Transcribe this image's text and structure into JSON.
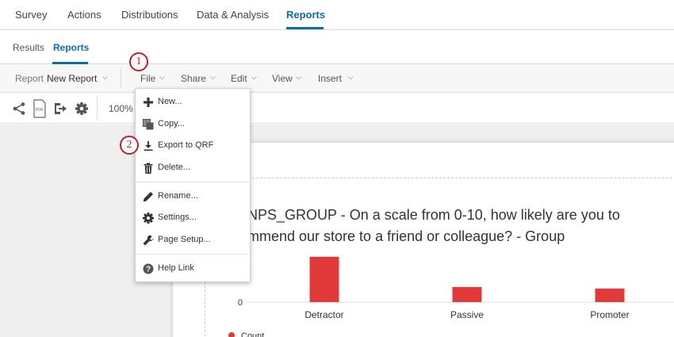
{
  "top_nav": {
    "tabs": [
      "Survey",
      "Actions",
      "Distributions",
      "Data & Analysis",
      "Reports"
    ],
    "active": "Reports"
  },
  "sub_nav": {
    "tabs": [
      "Results",
      "Reports"
    ],
    "active": "Reports"
  },
  "toolbar": {
    "report_label": "Report",
    "report_name": "New Report",
    "menus": [
      "File",
      "Share",
      "Edit",
      "View",
      "Insert"
    ]
  },
  "icon_row": {
    "icons": [
      "share-icon",
      "pdf-icon",
      "export-icon",
      "gear-icon"
    ],
    "zoom": "100%"
  },
  "file_menu": {
    "items": [
      {
        "label": "New...",
        "icon": "plus-icon"
      },
      {
        "label": "Copy...",
        "icon": "copy-icon"
      },
      {
        "label": "Export to QRF",
        "icon": "download-icon"
      },
      {
        "label": "Delete...",
        "icon": "trash-icon"
      },
      {
        "label": "Rename...",
        "icon": "pencil-icon"
      },
      {
        "label": "Settings...",
        "icon": "gear-icon"
      },
      {
        "label": "Page Setup...",
        "icon": "wrench-icon"
      },
      {
        "label": "Help Link",
        "icon": "help-icon"
      }
    ]
  },
  "annotations": {
    "step1": "1",
    "step2": "2"
  },
  "report": {
    "title_line1": "NPS_GROUP - On a scale from 0-10, how likely are you to",
    "title_line2": "mmend our store to a friend or colleague? - Group",
    "legend_label": "Count"
  },
  "colors": {
    "accent": "#0b6ea8",
    "bar": "#e23a3a",
    "badge": "#b8202b"
  },
  "chart_data": {
    "type": "bar",
    "categories": [
      "Detractor",
      "Passive",
      "Promoter"
    ],
    "values": [
      3,
      1,
      0.9
    ],
    "y_tick_labels": [
      "0"
    ],
    "ylim": [
      0,
      3.2
    ],
    "series": [
      {
        "name": "Count",
        "values": [
          3,
          1,
          0.9
        ]
      }
    ]
  }
}
